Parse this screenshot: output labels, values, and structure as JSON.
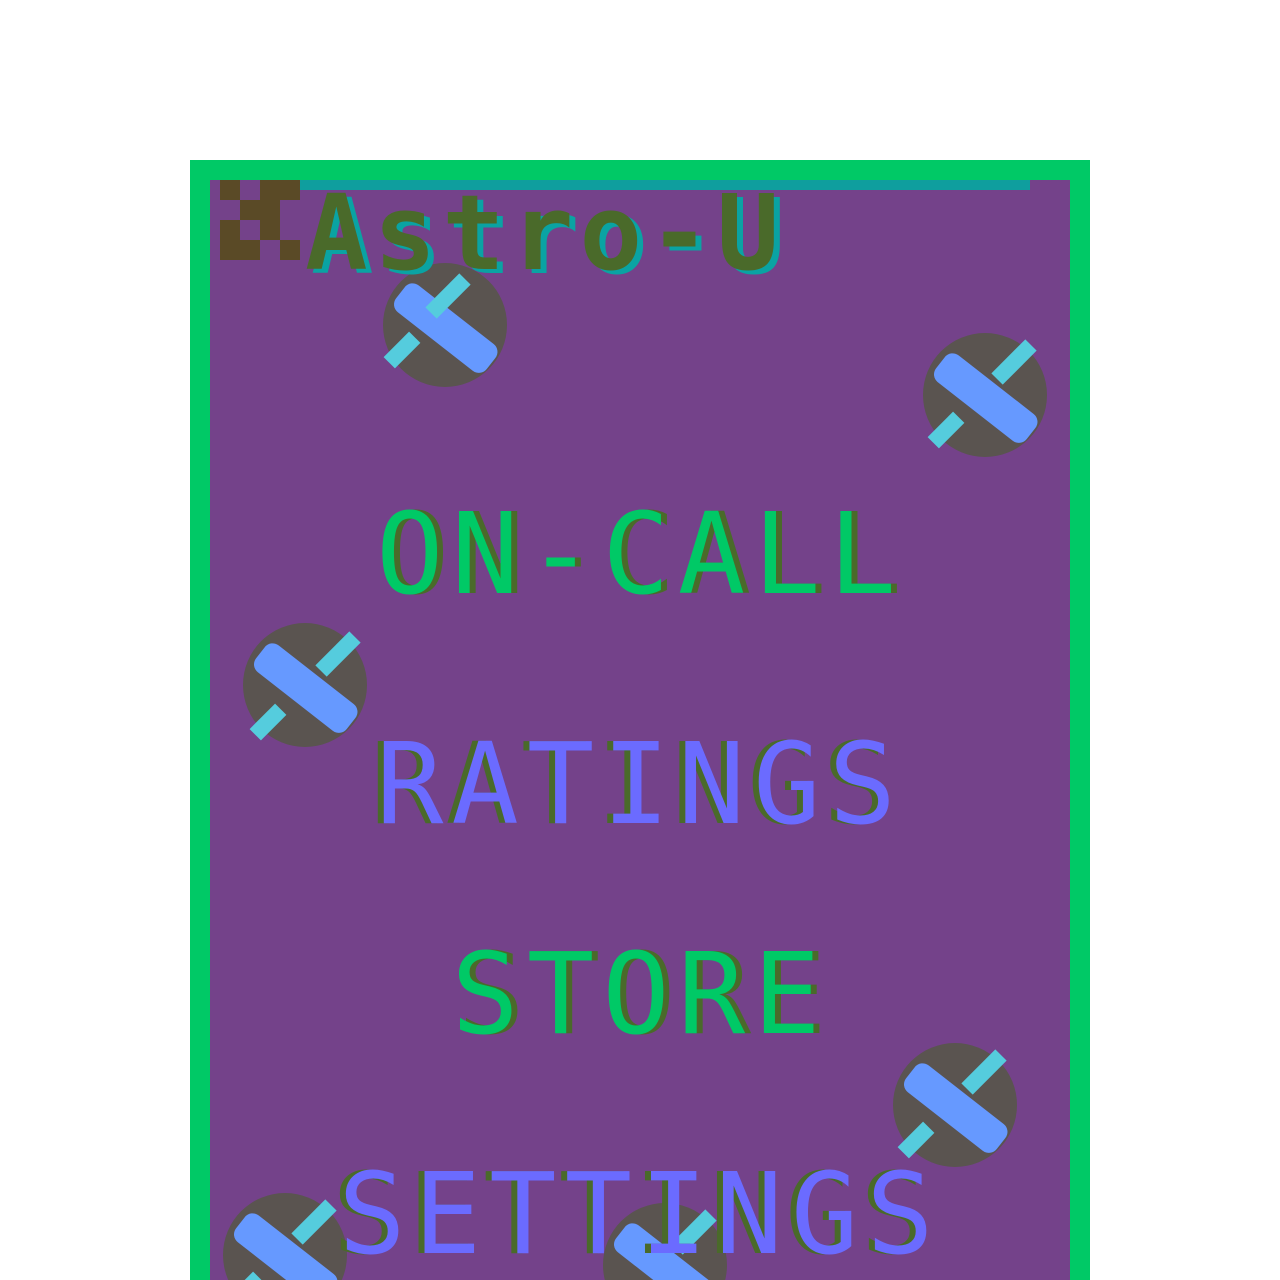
{
  "app": {
    "title": "Astro-U"
  },
  "menu": {
    "items": [
      {
        "label": "ON-CALL"
      },
      {
        "label": "RATINGS"
      },
      {
        "label": "STORE"
      },
      {
        "label": "SETTINGS"
      }
    ]
  },
  "colors": {
    "border": "#00c966",
    "panel": "#74428a",
    "title_accent": "#0aa3a3",
    "title_shadow": "#4a6a2a",
    "menu_green": "#00c966",
    "menu_blue": "#6b6bff",
    "asteroid_rock": "#5a5450",
    "asteroid_band": "#6699ff",
    "asteroid_highlight": "#55ccdd"
  },
  "decorations": {
    "asteroid_icon": "asteroid-icon",
    "checker_icon": "checker-pattern-icon"
  }
}
